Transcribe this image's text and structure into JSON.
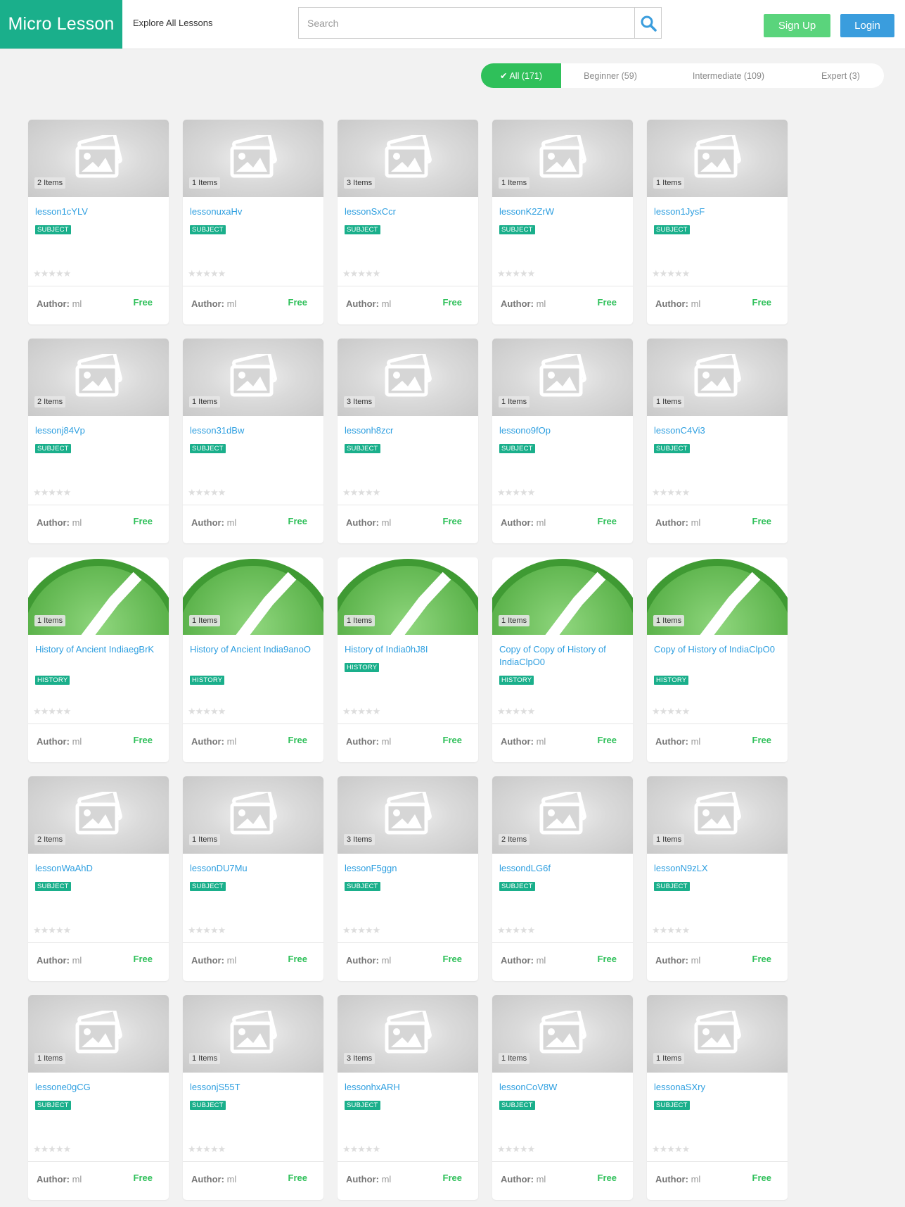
{
  "header": {
    "logo": "Micro Lesson",
    "explore_label": "Explore All Lessons",
    "search_placeholder": "Search",
    "signup_label": "Sign Up",
    "login_label": "Login"
  },
  "filters": [
    {
      "label": "All (171)",
      "active": true
    },
    {
      "label": "Beginner (59)",
      "active": false
    },
    {
      "label": "Intermediate (109)",
      "active": false
    },
    {
      "label": "Expert (3)",
      "active": false
    }
  ],
  "labels": {
    "author_prefix": "Author:",
    "rating_stars": "★★★★★"
  },
  "colors": {
    "brand": "#1aaf8b",
    "signup": "#5ad47c",
    "login": "#3a9ddd",
    "active_filter": "#2fc05a",
    "link": "#2e9fe0",
    "price": "#2fc05a"
  },
  "lessons": [
    {
      "items": "2 Items",
      "title": "lesson1cYLV",
      "tag": "SUBJECT",
      "author": "ml",
      "price": "Free",
      "thumb": "placeholder"
    },
    {
      "items": "1 Items",
      "title": "lessonuxaHv",
      "tag": "SUBJECT",
      "author": "ml",
      "price": "Free",
      "thumb": "placeholder"
    },
    {
      "items": "3 Items",
      "title": "lessonSxCcr",
      "tag": "SUBJECT",
      "author": "ml",
      "price": "Free",
      "thumb": "placeholder"
    },
    {
      "items": "1 Items",
      "title": "lessonK2ZrW",
      "tag": "SUBJECT",
      "author": "ml",
      "price": "Free",
      "thumb": "placeholder"
    },
    {
      "items": "1 Items",
      "title": "lesson1JysF",
      "tag": "SUBJECT",
      "author": "ml",
      "price": "Free",
      "thumb": "placeholder"
    },
    {
      "items": "2 Items",
      "title": "lessonj84Vp",
      "tag": "SUBJECT",
      "author": "ml",
      "price": "Free",
      "thumb": "placeholder"
    },
    {
      "items": "1 Items",
      "title": "lesson31dBw",
      "tag": "SUBJECT",
      "author": "ml",
      "price": "Free",
      "thumb": "placeholder"
    },
    {
      "items": "3 Items",
      "title": "lessonh8zcr",
      "tag": "SUBJECT",
      "author": "ml",
      "price": "Free",
      "thumb": "placeholder"
    },
    {
      "items": "1 Items",
      "title": "lessono9fOp",
      "tag": "SUBJECT",
      "author": "ml",
      "price": "Free",
      "thumb": "placeholder"
    },
    {
      "items": "1 Items",
      "title": "lessonC4Vi3",
      "tag": "SUBJECT",
      "author": "ml",
      "price": "Free",
      "thumb": "placeholder"
    },
    {
      "items": "1 Items",
      "title": "History of Ancient IndiaegBrK",
      "tag": "HISTORY",
      "author": "ml",
      "price": "Free",
      "thumb": "check"
    },
    {
      "items": "1 Items",
      "title": "History of Ancient India9anoO",
      "tag": "HISTORY",
      "author": "ml",
      "price": "Free",
      "thumb": "check"
    },
    {
      "items": "1 Items",
      "title": "History of India0hJ8I",
      "tag": "HISTORY",
      "author": "ml",
      "price": "Free",
      "thumb": "check"
    },
    {
      "items": "1 Items",
      "title": "Copy of Copy of History of IndiaClpO0",
      "tag": "HISTORY",
      "author": "ml",
      "price": "Free",
      "thumb": "check"
    },
    {
      "items": "1 Items",
      "title": "Copy of History of IndiaClpO0",
      "tag": "HISTORY",
      "author": "ml",
      "price": "Free",
      "thumb": "check"
    },
    {
      "items": "2 Items",
      "title": "lessonWaAhD",
      "tag": "SUBJECT",
      "author": "ml",
      "price": "Free",
      "thumb": "placeholder"
    },
    {
      "items": "1 Items",
      "title": "lessonDU7Mu",
      "tag": "SUBJECT",
      "author": "ml",
      "price": "Free",
      "thumb": "placeholder"
    },
    {
      "items": "3 Items",
      "title": "lessonF5ggn",
      "tag": "SUBJECT",
      "author": "ml",
      "price": "Free",
      "thumb": "placeholder"
    },
    {
      "items": "2 Items",
      "title": "lessondLG6f",
      "tag": "SUBJECT",
      "author": "ml",
      "price": "Free",
      "thumb": "placeholder"
    },
    {
      "items": "1 Items",
      "title": "lessonN9zLX",
      "tag": "SUBJECT",
      "author": "ml",
      "price": "Free",
      "thumb": "placeholder"
    },
    {
      "items": "1 Items",
      "title": "lessone0gCG",
      "tag": "SUBJECT",
      "author": "ml",
      "price": "Free",
      "thumb": "placeholder"
    },
    {
      "items": "1 Items",
      "title": "lessonjS55T",
      "tag": "SUBJECT",
      "author": "ml",
      "price": "Free",
      "thumb": "placeholder"
    },
    {
      "items": "3 Items",
      "title": "lessonhxARH",
      "tag": "SUBJECT",
      "author": "ml",
      "price": "Free",
      "thumb": "placeholder"
    },
    {
      "items": "1 Items",
      "title": "lessonCoV8W",
      "tag": "SUBJECT",
      "author": "ml",
      "price": "Free",
      "thumb": "placeholder"
    },
    {
      "items": "1 Items",
      "title": "lessonaSXry",
      "tag": "SUBJECT",
      "author": "ml",
      "price": "Free",
      "thumb": "placeholder"
    }
  ]
}
